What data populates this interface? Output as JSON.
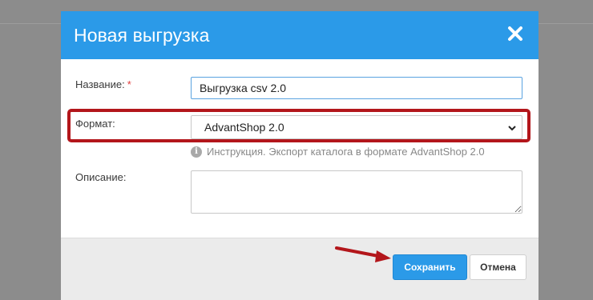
{
  "dialog": {
    "title": "Новая выгрузка",
    "close_icon": "close-icon"
  },
  "form": {
    "name_label": "Название:",
    "name_required_marker": "*",
    "name_value": "Выгрузка csv 2.0",
    "format_label": "Формат:",
    "format_selected": "AdvantShop 2.0",
    "format_hint": "Инструкция. Экспорт каталога в формате AdvantShop 2.0",
    "description_label": "Описание:",
    "description_value": ""
  },
  "footer": {
    "save_label": "Сохранить",
    "cancel_label": "Отмена"
  },
  "colors": {
    "header": "#2b9ae8",
    "highlight": "#b3161b",
    "arrow": "#b3161b",
    "required": "#e03a3a"
  }
}
